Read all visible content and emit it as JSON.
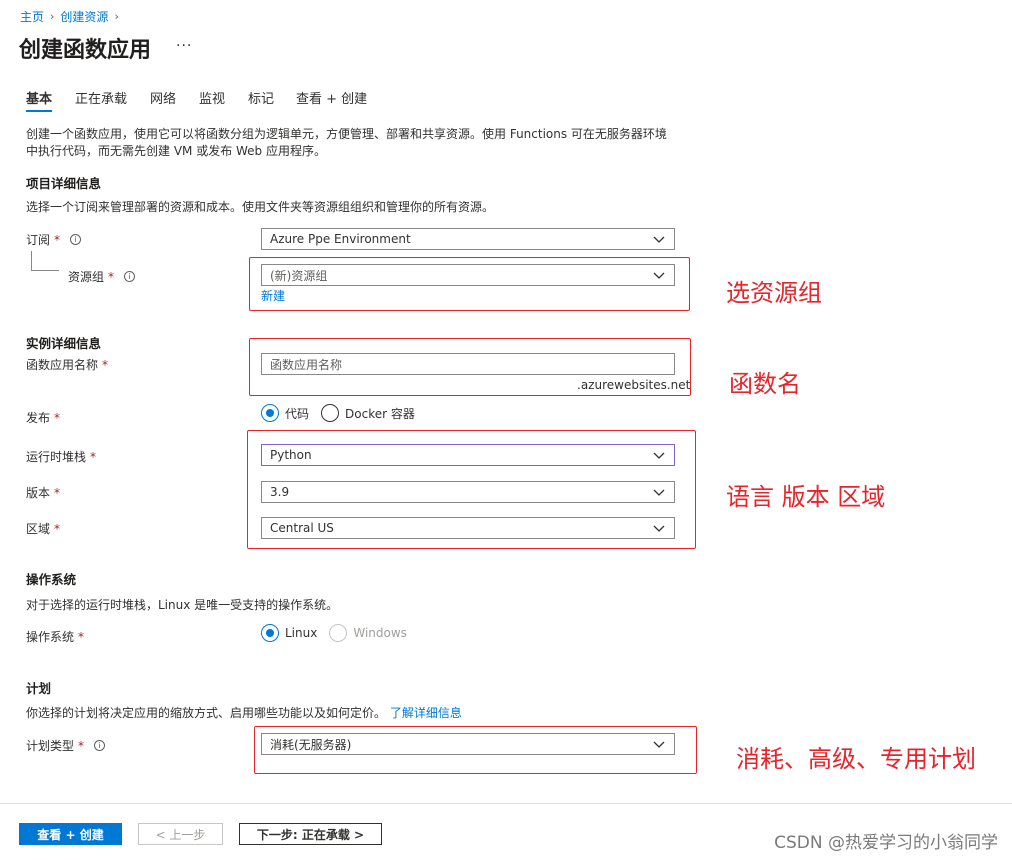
{
  "breadcrumb": [
    {
      "label": "主页"
    },
    {
      "label": "创建资源"
    }
  ],
  "page": {
    "title": "创建函数应用",
    "more": "···"
  },
  "tabs": [
    {
      "label": "基本"
    },
    {
      "label": "正在承载"
    },
    {
      "label": "网络"
    },
    {
      "label": "监视"
    },
    {
      "label": "标记"
    },
    {
      "label": "查看 + 创建"
    }
  ],
  "intro": {
    "line1": "创建一个函数应用，使用它可以将函数分组为逻辑单元，方便管理、部署和共享资源。使用 Functions 可在无服务器环境",
    "line2": "中执行代码，而无需先创建 VM 或发布 Web 应用程序。"
  },
  "project": {
    "title": "项目详细信息",
    "desc": "选择一个订阅来管理部署的资源和成本。使用文件夹等资源组组织和管理你的所有资源。",
    "subscription_label": "订阅",
    "subscription_value": "Azure Ppe Environment",
    "resource_group_label": "资源组",
    "resource_group_value": "(新)资源组",
    "new_link": "新建"
  },
  "instance": {
    "title": "实例详细信息",
    "name_label": "函数应用名称",
    "name_placeholder": "函数应用名称",
    "name_suffix": ".azurewebsites.net",
    "publish_label": "发布",
    "publish_options": [
      "代码",
      "Docker 容器"
    ],
    "runtime_label": "运行时堆栈",
    "runtime_value": "Python",
    "version_label": "版本",
    "version_value": "3.9",
    "region_label": "区域",
    "region_value": "Central US"
  },
  "os": {
    "title": "操作系统",
    "desc": "对于选择的运行时堆栈，Linux 是唯一受支持的操作系统。",
    "label": "操作系统",
    "options": [
      "Linux",
      "Windows"
    ]
  },
  "plan": {
    "title": "计划",
    "desc": "你选择的计划将决定应用的缩放方式、启用哪些功能以及如何定价。",
    "learn_more": "了解详细信息",
    "type_label": "计划类型",
    "type_value": "消耗(无服务器)"
  },
  "annotations": {
    "resource_group": "选资源组",
    "function_name": "函数名",
    "language": "语言 版本 区域",
    "plan": "消耗、高级、专用计划"
  },
  "footer": {
    "review_create": "查看 + 创建",
    "previous": "< 上一步",
    "next": "下一步: 正在承载 >"
  },
  "watermark": "CSDN @热爱学习的小翁同学",
  "colors": {
    "accent": "#0078d4",
    "annotation": "#e8242b",
    "required": "#a4262c"
  }
}
